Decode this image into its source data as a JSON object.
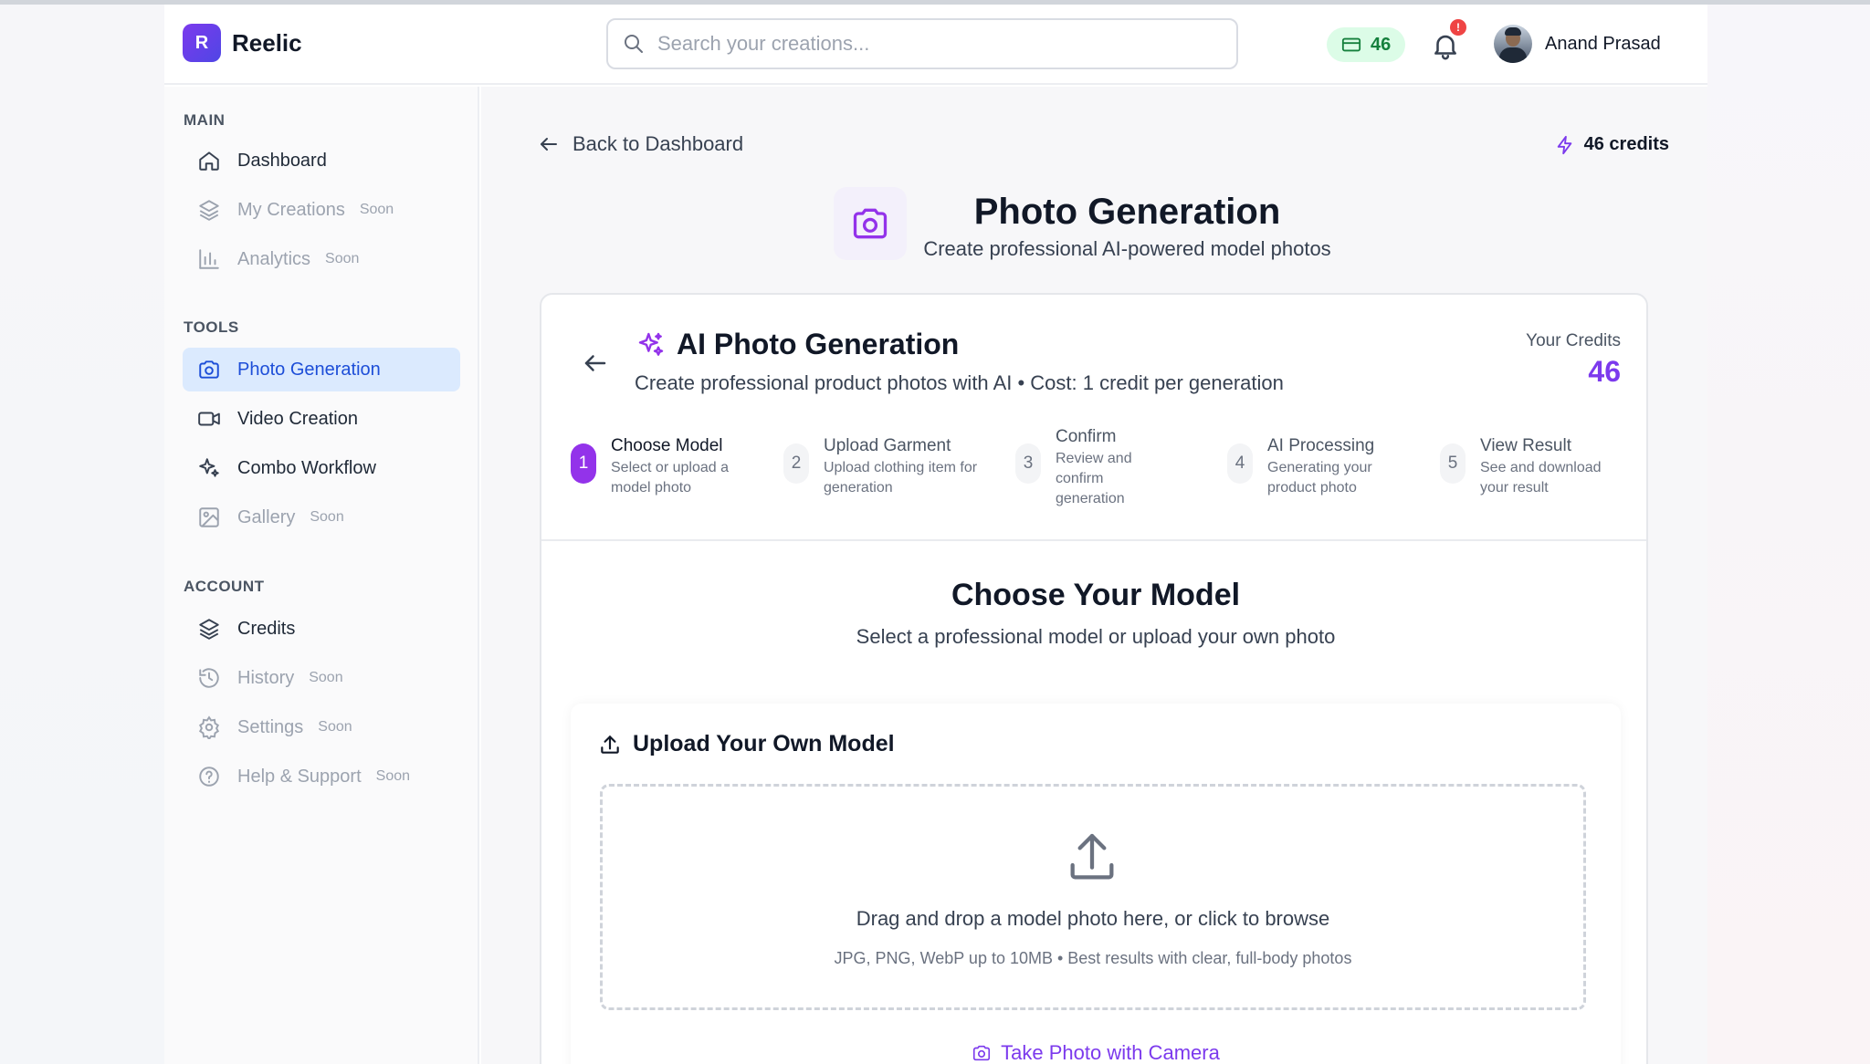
{
  "brand": {
    "logo_letter": "R",
    "name": "Reelic"
  },
  "header": {
    "search_placeholder": "Search your creations...",
    "credits_badge": "46",
    "notification_count": "!",
    "user_name": "Anand Prasad"
  },
  "sidebar": {
    "sections": {
      "main": "MAIN",
      "tools": "TOOLS",
      "account": "ACCOUNT"
    },
    "items": {
      "dashboard": {
        "label": "Dashboard"
      },
      "my_creations": {
        "label": "My Creations",
        "badge": "Soon"
      },
      "analytics": {
        "label": "Analytics",
        "badge": "Soon"
      },
      "photo_generation": {
        "label": "Photo Generation"
      },
      "video_creation": {
        "label": "Video Creation"
      },
      "combo_workflow": {
        "label": "Combo Workflow"
      },
      "gallery": {
        "label": "Gallery",
        "badge": "Soon"
      },
      "credits": {
        "label": "Credits"
      },
      "history": {
        "label": "History",
        "badge": "Soon"
      },
      "settings": {
        "label": "Settings",
        "badge": "Soon"
      },
      "help": {
        "label": "Help & Support",
        "badge": "Soon"
      }
    }
  },
  "main": {
    "back_label": "Back to Dashboard",
    "top_credits": "46 credits",
    "page_title": "Photo Generation",
    "page_subtitle": "Create professional AI-powered model photos",
    "card": {
      "title": "AI Photo Generation",
      "subtitle": "Create professional product photos with AI • Cost: 1 credit per generation",
      "your_credits_label": "Your Credits",
      "your_credits_value": "46",
      "steps": [
        {
          "num": "1",
          "title": "Choose Model",
          "desc": "Select or upload a model photo"
        },
        {
          "num": "2",
          "title": "Upload Garment",
          "desc": "Upload clothing item for generation"
        },
        {
          "num": "3",
          "title": "Confirm",
          "desc": "Review and confirm generation"
        },
        {
          "num": "4",
          "title": "AI Processing",
          "desc": "Generating your product photo"
        },
        {
          "num": "5",
          "title": "View Result",
          "desc": "See and download your result"
        }
      ],
      "choose_title": "Choose Your Model",
      "choose_subtitle": "Select a professional model or upload your own photo",
      "upload_title": "Upload Your Own Model",
      "dropzone_text": "Drag and drop a model photo here, or click to browse",
      "dropzone_hint": "JPG, PNG, WebP up to 10MB • Best results with clear, full-body photos",
      "camera_label": "Take Photo with Camera"
    }
  },
  "colors": {
    "accent": "#7c3aed",
    "active_nav_bg": "#dbeafe",
    "credit_green": "#15803d"
  }
}
